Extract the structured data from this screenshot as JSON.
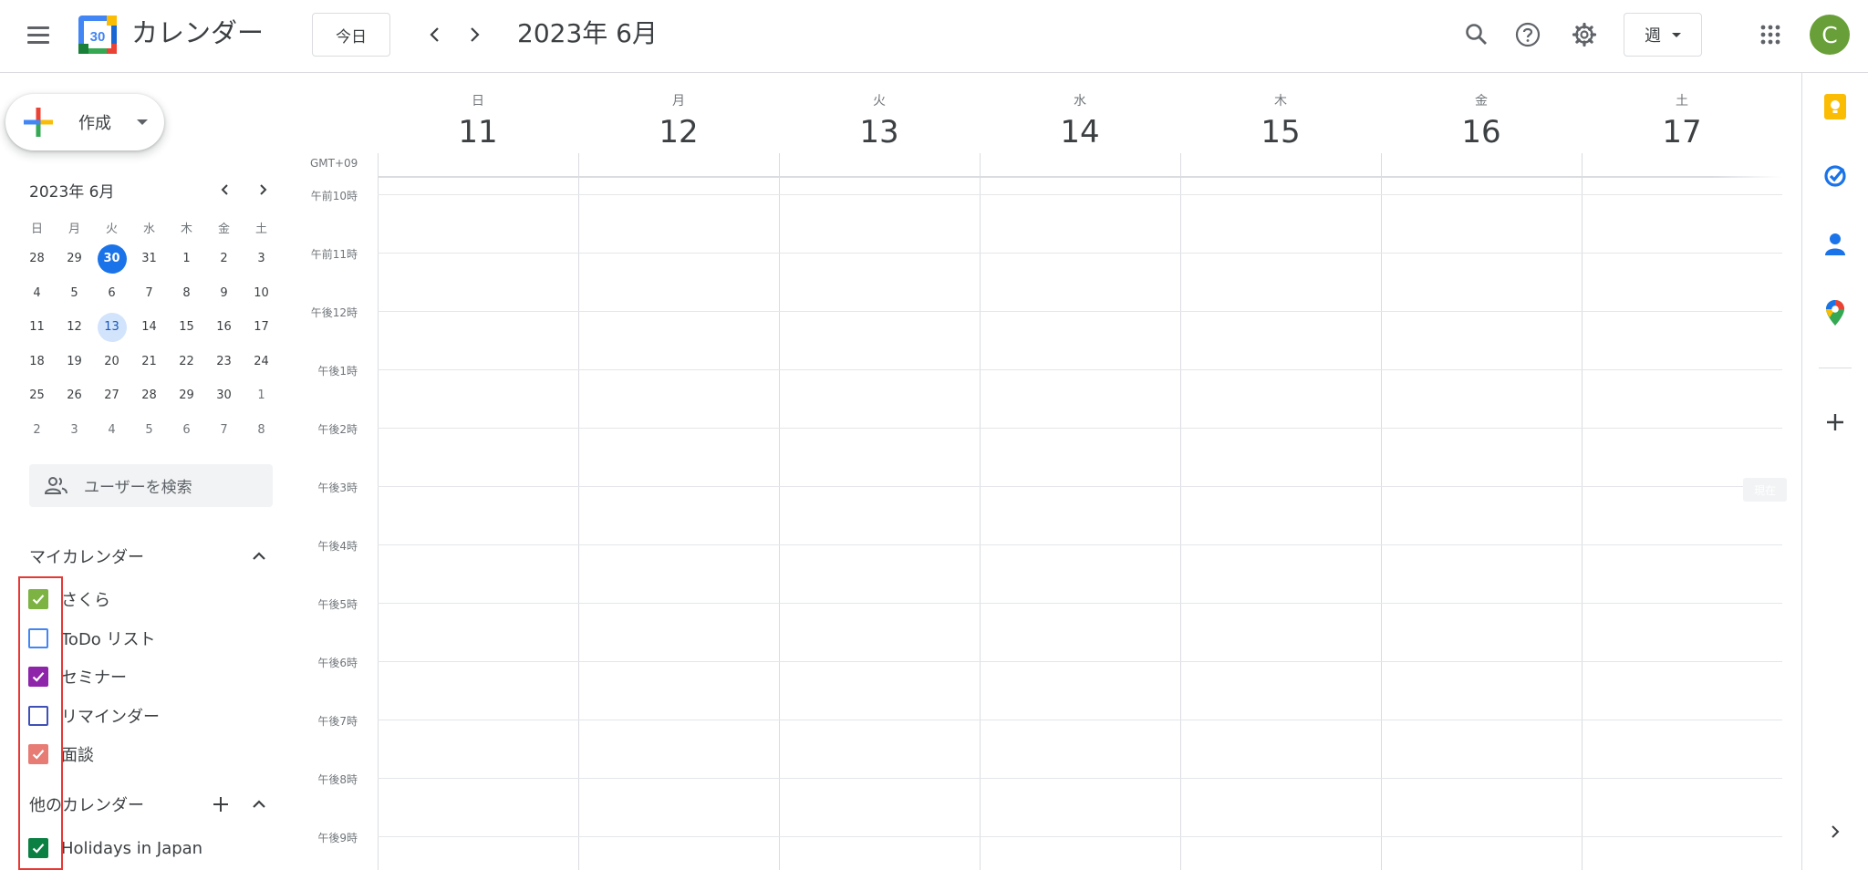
{
  "header": {
    "app_title": "カレンダー",
    "logo_number": "30",
    "today_label": "今日",
    "period_title": "2023年 6月",
    "view_label": "週",
    "avatar_initial": "C"
  },
  "create": {
    "label": "作成"
  },
  "mini_calendar": {
    "title": "2023年 6月",
    "weekdays": [
      "日",
      "月",
      "火",
      "水",
      "木",
      "金",
      "土"
    ],
    "days": [
      {
        "n": "28",
        "other": false
      },
      {
        "n": "29",
        "other": false
      },
      {
        "n": "30",
        "today": true
      },
      {
        "n": "31"
      },
      {
        "n": "1"
      },
      {
        "n": "2"
      },
      {
        "n": "3"
      },
      {
        "n": "4"
      },
      {
        "n": "5"
      },
      {
        "n": "6"
      },
      {
        "n": "7"
      },
      {
        "n": "8"
      },
      {
        "n": "9"
      },
      {
        "n": "10"
      },
      {
        "n": "11"
      },
      {
        "n": "12"
      },
      {
        "n": "13",
        "selected": true
      },
      {
        "n": "14"
      },
      {
        "n": "15"
      },
      {
        "n": "16"
      },
      {
        "n": "17"
      },
      {
        "n": "18"
      },
      {
        "n": "19"
      },
      {
        "n": "20"
      },
      {
        "n": "21"
      },
      {
        "n": "22"
      },
      {
        "n": "23"
      },
      {
        "n": "24"
      },
      {
        "n": "25"
      },
      {
        "n": "26"
      },
      {
        "n": "27"
      },
      {
        "n": "28"
      },
      {
        "n": "29"
      },
      {
        "n": "30"
      },
      {
        "n": "1",
        "other": true
      },
      {
        "n": "2",
        "other": true
      },
      {
        "n": "3",
        "other": true
      },
      {
        "n": "4",
        "other": true
      },
      {
        "n": "5",
        "other": true
      },
      {
        "n": "6",
        "other": true
      },
      {
        "n": "7",
        "other": true
      },
      {
        "n": "8",
        "other": true
      }
    ]
  },
  "people_search": {
    "placeholder": "ユーザーを検索"
  },
  "my_calendars": {
    "title": "マイカレンダー",
    "items": [
      {
        "label": "さくら",
        "checked": true,
        "color": "#7cb342"
      },
      {
        "label": "ToDo リスト",
        "checked": false,
        "color": "#4285f4"
      },
      {
        "label": "セミナー",
        "checked": true,
        "color": "#8e24aa"
      },
      {
        "label": "リマインダー",
        "checked": false,
        "color": "#3f51b5"
      },
      {
        "label": "面談",
        "checked": true,
        "color": "#e67c73"
      }
    ]
  },
  "other_calendars": {
    "title": "他のカレンダー",
    "items": [
      {
        "label": "Holidays in Japan",
        "checked": true,
        "color": "#0b8043"
      }
    ]
  },
  "week": {
    "timezone": "GMT+09",
    "days": [
      {
        "dow": "日",
        "num": "11"
      },
      {
        "dow": "月",
        "num": "12"
      },
      {
        "dow": "火",
        "num": "13"
      },
      {
        "dow": "水",
        "num": "14"
      },
      {
        "dow": "木",
        "num": "15"
      },
      {
        "dow": "金",
        "num": "16"
      },
      {
        "dow": "土",
        "num": "17"
      }
    ],
    "hours": [
      "午前10時",
      "午前11時",
      "午後12時",
      "午後1時",
      "午後2時",
      "午後3時",
      "午後4時",
      "午後5時",
      "午後6時",
      "午後7時",
      "午後8時",
      "午後9時"
    ],
    "now_chip": "現在"
  },
  "colors": {
    "accent": "#1a73e8",
    "highlight": "#e53935"
  }
}
